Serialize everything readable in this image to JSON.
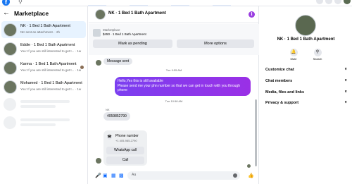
{
  "topbar": {
    "logo": "f",
    "search_icon": "search-icon"
  },
  "left": {
    "title": "Marketplace",
    "conversations": [
      {
        "name": "NK · 1 Bed 1 Bath Apartment",
        "preview": "NK sent an attachment. · 2h",
        "time": ""
      },
      {
        "name": "Eddie · 1 Bed 1 Bath Apartment",
        "preview": "You: If you are still interested to get t...",
        "time": "1w"
      },
      {
        "name": "Karma · 1 Bed 1 Bath Apartment",
        "preview": "You: If you are still interested to get t...",
        "time": "1w"
      },
      {
        "name": "Mohamed · 1 Bed 1 Bath Apartment",
        "preview": "You: If you are still interested to get t...",
        "time": "1w"
      }
    ]
  },
  "chat": {
    "header_name": "NK · 1 Bed 1 Bath Apartment",
    "info_icon": "i",
    "listing_source": "Marketplace",
    "listing_title": "$450 · 1 Bed 1 Bath Apartment",
    "mark_pending": "Mark as pending",
    "more_options": "More options",
    "msg_sender": "Message sent",
    "time1": "Tue 9:55 AM",
    "outgoing_lines": [
      "Hello,Yes this is still available",
      "Please send me your phn number so that we can get in touch with you through",
      "phone"
    ],
    "time2": "Tue 10:58 AM",
    "sender_label": "NK",
    "phone_message": "4059852790",
    "contact_title": "Phone number",
    "contact_number": "+1 405-985-2790",
    "whatsapp": "WhatsApp call",
    "call": "Call",
    "composer_placeholder": "Aa"
  },
  "right": {
    "title": "NK · 1 Bed 1 Bath Apartment",
    "mute": "Mute",
    "search": "Search",
    "sections": [
      "Customize chat",
      "Chat members",
      "Media, files and links",
      "Privacy & support"
    ]
  }
}
